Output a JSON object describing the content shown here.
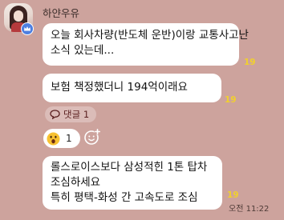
{
  "sender": {
    "name": "하얀우유",
    "avatar_icon": "profile-avatar-icon",
    "badge_icon": "crown-icon",
    "badge_color": "#4d7fe0"
  },
  "messages": [
    {
      "lines": [
        "오늘 회사차량(반도체 운반)이랑 교통사고난",
        "소식 있는데..."
      ],
      "unread": "19"
    },
    {
      "lines": [
        "보험 책정했더니 194억이래요"
      ],
      "unread": "19"
    },
    {
      "lines": [
        "롤스로이스보다 삼성적힌 1톤 탑차",
        "조심하세요",
        "특히 평택-화성 간 고속도로 조심"
      ],
      "unread": "19",
      "time": "오전 11:22"
    }
  ],
  "reply_thread": {
    "label": "댓글 1",
    "icon": "speech-bubble-icon"
  },
  "reactions": {
    "emoji_icon": "surprised-face-icon",
    "count": "1",
    "add_icon": "add-reaction-icon"
  },
  "colors": {
    "background": "#cda39d",
    "bubble": "#ffffff",
    "unread": "#f1d02d",
    "reply_text": "#5a1f1f"
  }
}
